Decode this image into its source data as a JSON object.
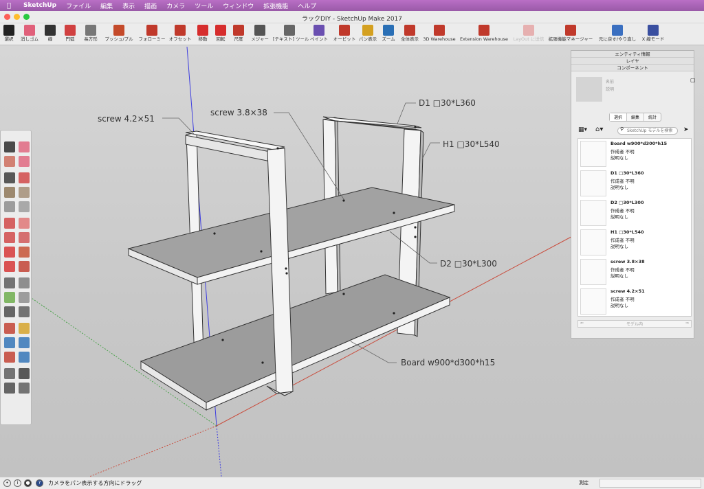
{
  "menu": {
    "app": "SketchUp",
    "items": [
      "ファイル",
      "編集",
      "表示",
      "描画",
      "カメラ",
      "ツール",
      "ウィンドウ",
      "拡張機能",
      "ヘルプ"
    ]
  },
  "window": {
    "title": "ラックDIY - SketchUp Make 2017"
  },
  "toolbar": {
    "items": [
      {
        "label": "選択",
        "icon": "select-arrow-icon",
        "color": "#222222"
      },
      {
        "label": "消しゴム",
        "icon": "eraser-icon",
        "color": "#e0607a"
      },
      {
        "label": "線",
        "icon": "pencil-icon",
        "color": "#333333"
      },
      {
        "label": "円弧",
        "icon": "arc-icon",
        "color": "#d04040"
      },
      {
        "label": "長方形",
        "icon": "rectangle-icon",
        "color": "#777777"
      },
      {
        "label": "プッシュ/プル",
        "icon": "push-pull-icon",
        "color": "#c44a2a"
      },
      {
        "label": "フォローミー",
        "icon": "follow-me-icon",
        "color": "#c0392b"
      },
      {
        "label": "オフセット",
        "icon": "offset-icon",
        "color": "#c0392b"
      },
      {
        "label": "移動",
        "icon": "move-icon",
        "color": "#d62d2d"
      },
      {
        "label": "回転",
        "icon": "rotate-icon",
        "color": "#d62d2d"
      },
      {
        "label": "尺度",
        "icon": "scale-icon",
        "color": "#c0392b"
      },
      {
        "label": "メジャー",
        "icon": "tape-measure-icon",
        "color": "#555555"
      },
      {
        "label": "[テキスト] ツール",
        "icon": "text-tool-icon",
        "color": "#666666"
      },
      {
        "label": "ペイント",
        "icon": "paint-bucket-icon",
        "color": "#6a4fb0"
      },
      {
        "label": "オービット",
        "icon": "orbit-icon",
        "color": "#c0392b"
      },
      {
        "label": "パン表示",
        "icon": "pan-hand-icon",
        "color": "#d4a020"
      },
      {
        "label": "ズーム",
        "icon": "zoom-icon",
        "color": "#2a6fb5"
      },
      {
        "label": "全体表示",
        "icon": "zoom-extents-icon",
        "color": "#c0392b"
      },
      {
        "label": "3D Warehouse",
        "icon": "warehouse-icon",
        "color": "#c0392b"
      },
      {
        "label": "Extension Warehouse",
        "icon": "extension-warehouse-icon",
        "color": "#c0392b"
      },
      {
        "label": "LayOut に送信",
        "icon": "layout-icon",
        "color": "#e6b0b0"
      },
      {
        "label": "拡張機能マネージャー",
        "icon": "extension-manager-icon",
        "color": "#c0392b"
      },
      {
        "label": "元に戻す/やり直し",
        "icon": "undo-redo-icon",
        "color": "#3a6fc0"
      },
      {
        "label": "X 線モード",
        "icon": "x-ray-icon",
        "color": "#3a4fa0"
      }
    ]
  },
  "annotations": [
    {
      "label": "screw 4.2×51"
    },
    {
      "label": "screw 3.8×38"
    },
    {
      "label": "D1 □30*L360"
    },
    {
      "label": "H1 □30*L540"
    },
    {
      "label": "D2 □30*L300"
    },
    {
      "label": "Board w900*d300*h15"
    }
  ],
  "panel": {
    "tabs": [
      "エンティティ情報",
      "レイヤ",
      "コンポーネント"
    ],
    "preview_name": "名前",
    "preview_desc": "説明",
    "segments": [
      "選択",
      "編集",
      "統計"
    ],
    "search_placeholder": "SketchUp モデルを検索",
    "components": [
      {
        "name": "Board w900*d300*h15",
        "author": "作成者 不明",
        "desc": "説明なし"
      },
      {
        "name": "D1 □30*L360",
        "author": "作成者 不明",
        "desc": "説明なし"
      },
      {
        "name": "D2 □30*L300",
        "author": "作成者 不明",
        "desc": "説明なし"
      },
      {
        "name": "H1 □30*L540",
        "author": "作成者 不明",
        "desc": "説明なし"
      },
      {
        "name": "screw 3.8×38",
        "author": "作成者 不明",
        "desc": "説明なし"
      },
      {
        "name": "screw 4.2×51",
        "author": "作成者 不明",
        "desc": "説明なし"
      }
    ],
    "footer": "モデル内"
  },
  "status": {
    "message": "カメラをパン表示する方向にドラッグ",
    "measure_label": "測定"
  }
}
